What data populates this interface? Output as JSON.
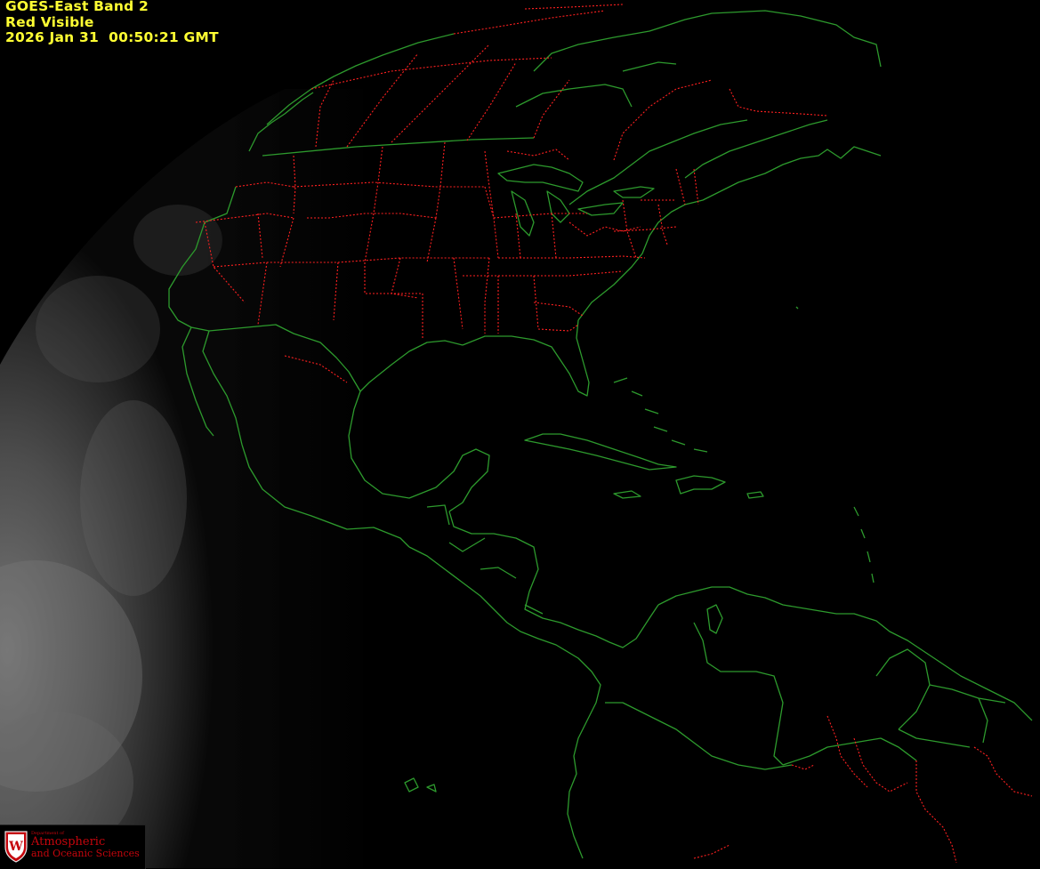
{
  "header": {
    "line1": "GOES-East Band 2",
    "line2": "Red Visible",
    "line3": "2026 Jan 31  00:50:21 GMT"
  },
  "logo": {
    "crest_letter": "W",
    "dept": "Department of",
    "line1": "Atmospheric",
    "line2": "and Oceanic Sciences"
  },
  "colors": {
    "background": "#000000",
    "caption": "#ffff33",
    "coastline": "#2d9a2d",
    "state_borders": "#ff2020",
    "logo_red": "#c5050c"
  },
  "icons": [
    "satellite-earth-disk",
    "uw-crest-icon"
  ]
}
